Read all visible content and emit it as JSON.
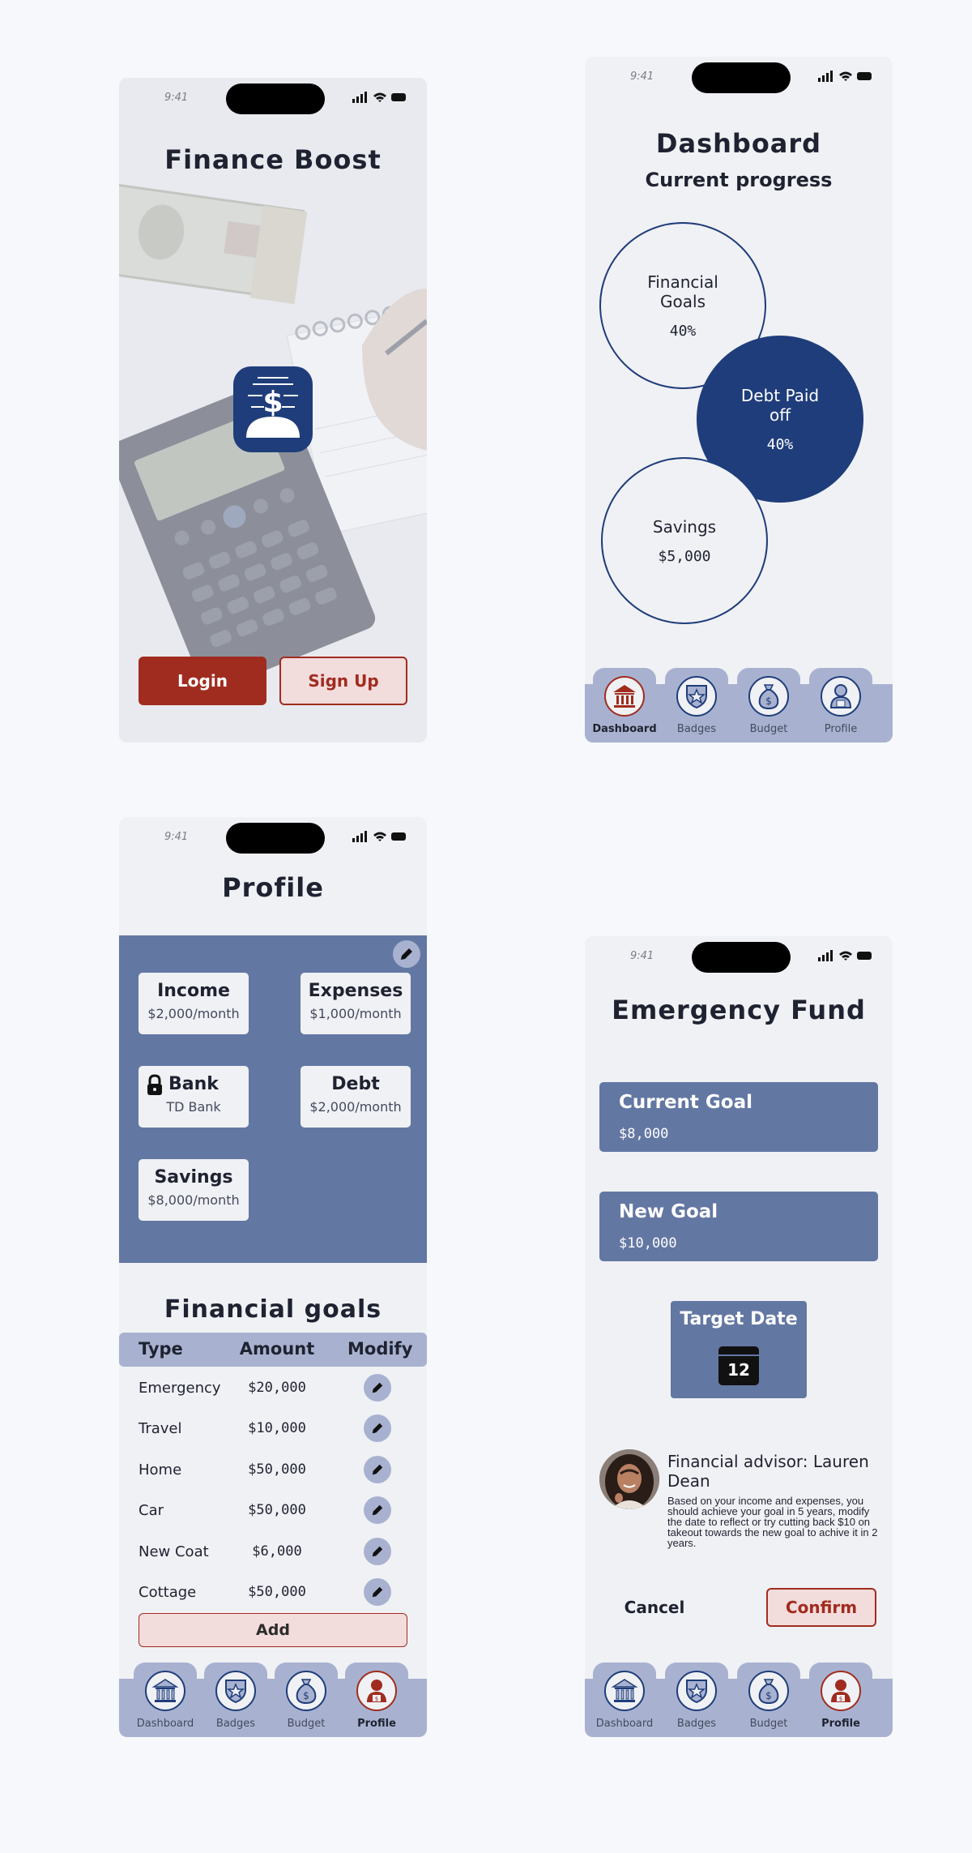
{
  "status": {
    "time": "9:41"
  },
  "login": {
    "title": "Finance Boost",
    "login_button": "Login",
    "signup_button": "Sign Up"
  },
  "dashboard": {
    "title": "Dashboard",
    "subtitle": "Current progress",
    "bubbles": [
      {
        "label": "Financial Goals",
        "value": "40%"
      },
      {
        "label": "Debt Paid off",
        "value": "40%"
      },
      {
        "label": "Savings",
        "value": "$5,000"
      }
    ]
  },
  "nav": {
    "items": [
      "Dashboard",
      "Badges",
      "Budget",
      "Profile"
    ]
  },
  "profile": {
    "title": "Profile",
    "cards": [
      {
        "label": "Income",
        "value": "$2,000/month"
      },
      {
        "label": "Expenses",
        "value": "$1,000/month"
      },
      {
        "label": "Bank",
        "value": "TD Bank"
      },
      {
        "label": "Debt",
        "value": "$2,000/month"
      },
      {
        "label": "Savings",
        "value": "$8,000/month"
      }
    ],
    "goals_title": "Financial goals",
    "goals_headers": [
      "Type",
      "Amount",
      "Modify"
    ],
    "goals": [
      {
        "type": "Emergency",
        "amount": "$20,000"
      },
      {
        "type": "Travel",
        "amount": "$10,000"
      },
      {
        "type": "Home",
        "amount": "$50,000"
      },
      {
        "type": "Car",
        "amount": "$50,000"
      },
      {
        "type": "New Coat",
        "amount": "$6,000"
      },
      {
        "type": "Cottage",
        "amount": "$50,000"
      }
    ],
    "add_button": "Add"
  },
  "emergency": {
    "title": "Emergency Fund",
    "current_goal_label": "Current Goal",
    "current_goal_value": "$8,000",
    "new_goal_label": "New Goal",
    "new_goal_value": "$10,000",
    "target_date_label": "Target Date",
    "calendar_day": "12",
    "advisor_name": "Financial advisor: Lauren Dean",
    "advisor_message": "Based on your income and expenses, you should achieve your goal in 5 years, modify the date to reflect or try cutting back $10 on takeout towards the new goal to achive it in 2 years.",
    "cancel_button": "Cancel",
    "confirm_button": "Confirm"
  },
  "colors": {
    "navy": "#1f3d7a",
    "slate": "#6377a3",
    "lavender": "#a8b2d0",
    "red": "#a02c1f",
    "pink": "#f3dcdc"
  }
}
